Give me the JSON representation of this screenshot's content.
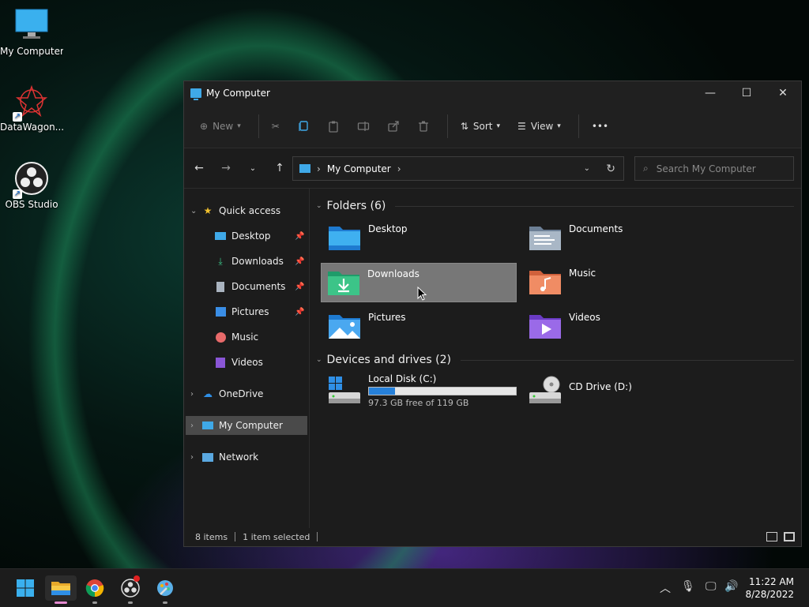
{
  "desktop": {
    "icons": [
      {
        "label": "My Computer"
      },
      {
        "label": "DataWagon..."
      },
      {
        "label": "OBS Studio"
      }
    ]
  },
  "window": {
    "title": "My Computer",
    "controls": {
      "minimize": "—",
      "maximize": "☐",
      "close": "✕"
    }
  },
  "toolbar": {
    "new_label": "New",
    "sort_label": "Sort",
    "view_label": "View",
    "more_label": "•••"
  },
  "address": {
    "path": "My Computer",
    "search_placeholder": "Search My Computer"
  },
  "sidebar": {
    "quick_access": "Quick access",
    "items": [
      {
        "label": "Desktop"
      },
      {
        "label": "Downloads"
      },
      {
        "label": "Documents"
      },
      {
        "label": "Pictures"
      },
      {
        "label": "Music"
      },
      {
        "label": "Videos"
      }
    ],
    "onedrive": "OneDrive",
    "mycomputer": "My Computer",
    "network": "Network"
  },
  "main": {
    "folders_header": "Folders (6)",
    "folders": [
      {
        "name": "Desktop"
      },
      {
        "name": "Documents"
      },
      {
        "name": "Downloads"
      },
      {
        "name": "Music"
      },
      {
        "name": "Pictures"
      },
      {
        "name": "Videos"
      }
    ],
    "drives_header": "Devices and drives (2)",
    "drives": [
      {
        "name": "Local Disk (C:)",
        "free": "97.3 GB free of 119 GB",
        "used_fraction": 0.18
      },
      {
        "name": "CD Drive (D:)"
      }
    ]
  },
  "status": {
    "items": "8 items",
    "selected": "1 item selected"
  },
  "taskbar": {
    "time": "11:22 AM",
    "date": "8/28/2022"
  },
  "colors": {
    "accent": "#2680d9",
    "selection": "#777777",
    "window_bg": "#1c1c1c"
  }
}
